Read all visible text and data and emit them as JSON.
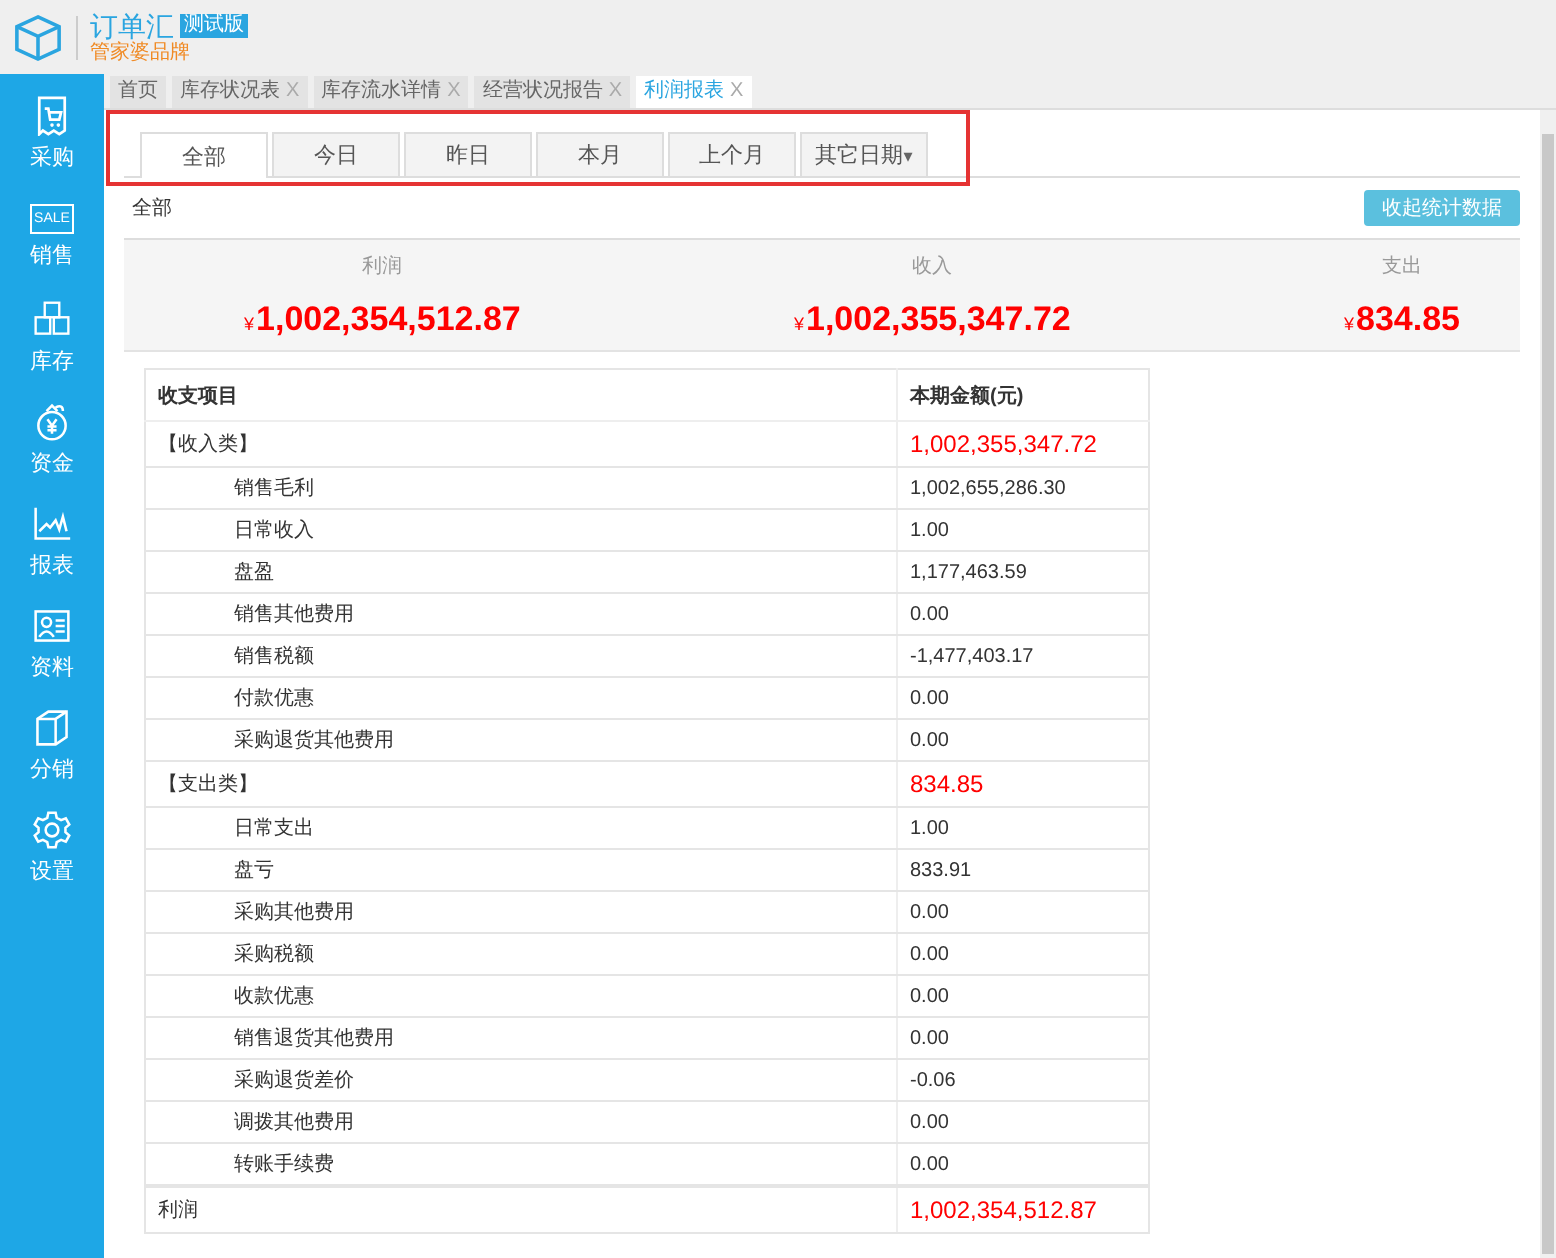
{
  "logo": {
    "title": "订单汇",
    "badge": "测试版",
    "subtitle": "管家婆品牌"
  },
  "sidebar": {
    "items": [
      {
        "label": "采购",
        "kind": "cart"
      },
      {
        "label": "销售",
        "kind": "sale",
        "icon_text": "SALE"
      },
      {
        "label": "库存",
        "kind": "boxes"
      },
      {
        "label": "资金",
        "kind": "money"
      },
      {
        "label": "报表",
        "kind": "chart"
      },
      {
        "label": "资料",
        "kind": "card"
      },
      {
        "label": "分销",
        "kind": "box"
      },
      {
        "label": "设置",
        "kind": "gear"
      }
    ]
  },
  "page_tabs": [
    {
      "label": "首页",
      "selected": false
    },
    {
      "label": "库存状况表",
      "close": "X",
      "selected": false
    },
    {
      "label": "库存流水详情",
      "close": "X",
      "selected": false
    },
    {
      "label": "经营状况报告",
      "close": "X",
      "selected": false
    },
    {
      "label": "利润报表",
      "close": "X",
      "selected": true
    }
  ],
  "period_tabs": [
    {
      "label": "全部",
      "selected": true
    },
    {
      "label": "今日",
      "selected": false
    },
    {
      "label": "昨日",
      "selected": false
    },
    {
      "label": "本月",
      "selected": false
    },
    {
      "label": "上个月",
      "selected": false
    },
    {
      "label": "其它日期",
      "caret": "▾",
      "selected": false
    }
  ],
  "filter_label": "全部",
  "collapse_button": "收起统计数据",
  "summary": [
    {
      "label": "利润",
      "currency": "¥",
      "value": "1,002,354,512.87"
    },
    {
      "label": "收入",
      "currency": "¥",
      "value": "1,002,355,347.72"
    },
    {
      "label": "支出",
      "currency": "¥",
      "value": "834.85"
    }
  ],
  "table": {
    "columns": [
      "收支项目",
      "本期金额(元)"
    ],
    "rows": [
      {
        "kind": "group",
        "item": "【收入类】",
        "amount": "1,002,355,347.72"
      },
      {
        "kind": "item",
        "item": "销售毛利",
        "amount": "1,002,655,286.30"
      },
      {
        "kind": "item",
        "item": "日常收入",
        "amount": "1.00"
      },
      {
        "kind": "item",
        "item": "盘盈",
        "amount": "1,177,463.59"
      },
      {
        "kind": "item",
        "item": "销售其他费用",
        "amount": "0.00"
      },
      {
        "kind": "item",
        "item": "销售税额",
        "amount": "-1,477,403.17"
      },
      {
        "kind": "item",
        "item": "付款优惠",
        "amount": "0.00"
      },
      {
        "kind": "item",
        "item": "采购退货其他费用",
        "amount": "0.00"
      },
      {
        "kind": "group",
        "item": "【支出类】",
        "amount": "834.85"
      },
      {
        "kind": "item",
        "item": "日常支出",
        "amount": "1.00"
      },
      {
        "kind": "item",
        "item": "盘亏",
        "amount": "833.91"
      },
      {
        "kind": "item",
        "item": "采购其他费用",
        "amount": "0.00"
      },
      {
        "kind": "item",
        "item": "采购税额",
        "amount": "0.00"
      },
      {
        "kind": "item",
        "item": "收款优惠",
        "amount": "0.00"
      },
      {
        "kind": "item",
        "item": "销售退货其他费用",
        "amount": "0.00"
      },
      {
        "kind": "item",
        "item": "采购退货差价",
        "amount": "-0.06"
      },
      {
        "kind": "item",
        "item": "调拨其他费用",
        "amount": "0.00"
      },
      {
        "kind": "item",
        "item": "转账手续费",
        "amount": "0.00"
      },
      {
        "kind": "total",
        "item": "利润",
        "amount": "1,002,354,512.87"
      }
    ]
  }
}
